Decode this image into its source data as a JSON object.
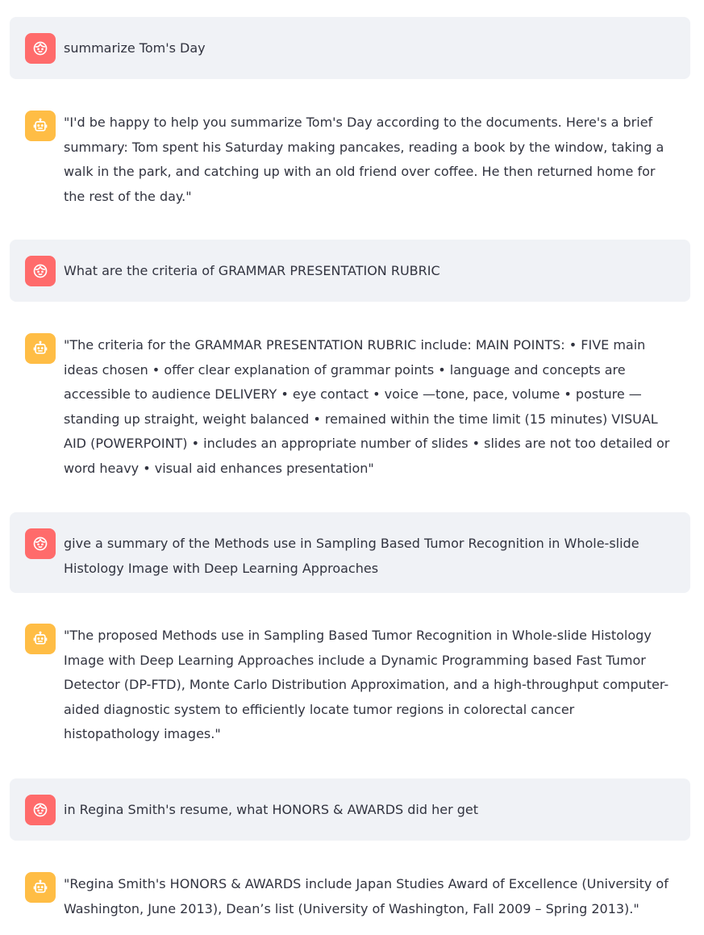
{
  "messages": [
    {
      "role": "user",
      "avatar_icon": "user-face-icon",
      "text": "summarize Tom's Day"
    },
    {
      "role": "assistant",
      "avatar_icon": "robot-icon",
      "text": "\"I'd be happy to help you summarize Tom's Day according to the documents. Here's a brief summary: Tom spent his Saturday making pancakes, reading a book by the window, taking a walk in the park, and catching up with an old friend over coffee. He then returned home for the rest of the day.\""
    },
    {
      "role": "user",
      "avatar_icon": "user-face-icon",
      "text": "What are the criteria of GRAMMAR PRESENTATION RUBRIC"
    },
    {
      "role": "assistant",
      "avatar_icon": "robot-icon",
      "text": "\"The criteria for the GRAMMAR PRESENTATION RUBRIC include: MAIN POINTS: • FIVE main ideas chosen • offer clear explanation of grammar points • language and concepts are accessible to audience DELIVERY • eye contact • voice —tone, pace, volume • posture —standing up straight, weight balanced • remained within the time limit (15 minutes) VISUAL AID (POWERPOINT) • includes an appropriate number of slides • slides are not too detailed or word heavy • visual aid enhances presentation\""
    },
    {
      "role": "user",
      "avatar_icon": "user-face-icon",
      "text": "give a summary of the Methods use in Sampling Based Tumor Recognition in Whole-slide Histology Image with Deep Learning Approaches"
    },
    {
      "role": "assistant",
      "avatar_icon": "robot-icon",
      "text": "\"The proposed Methods use in Sampling Based Tumor Recognition in Whole-slide Histology Image with Deep Learning Approaches include a Dynamic Programming based Fast Tumor Detector (DP-FTD), Monte Carlo Distribution Approximation, and a high-throughput computer-aided diagnostic system to efficiently locate tumor regions in colorectal cancer histopathology images.\""
    },
    {
      "role": "user",
      "avatar_icon": "user-face-icon",
      "text": "in Regina Smith's resume, what HONORS & AWARDS did her get"
    },
    {
      "role": "assistant",
      "avatar_icon": "robot-icon",
      "text": "\"Regina Smith's HONORS & AWARDS include Japan Studies Award of Excellence (University of Washington, June 2013), Dean’s list (University of Washington, Fall 2009 – Spring 2013).\""
    }
  ],
  "colors": {
    "user_bubble_bg": "#f0f2f6",
    "user_avatar_bg": "#ff6b6b",
    "assistant_avatar_bg": "#ffbd45",
    "text": "#31333f"
  }
}
